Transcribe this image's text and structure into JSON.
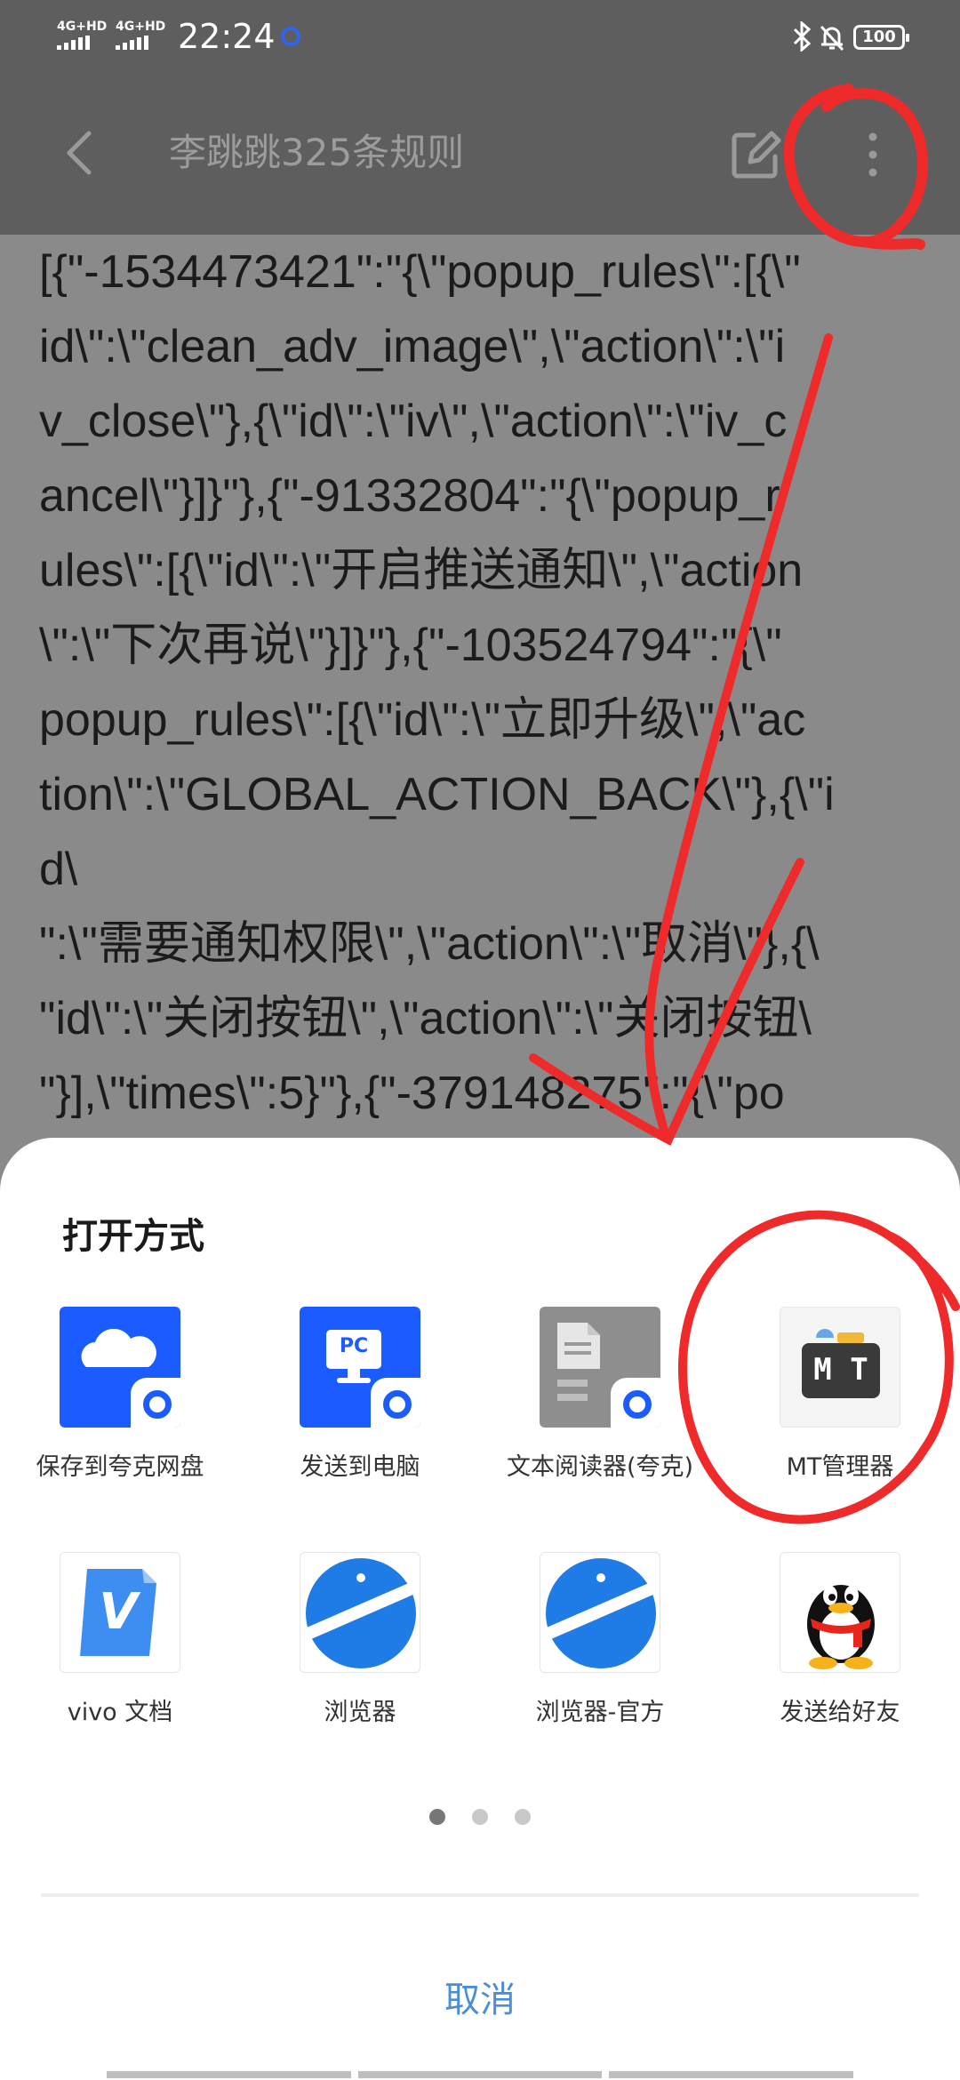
{
  "status_bar": {
    "network_1": "4G+HD",
    "network_2": "4G+HD",
    "time": "22:24",
    "battery": "100"
  },
  "header": {
    "title": "李跳跳325条规则"
  },
  "document": {
    "lines": [
      "[{\"-1534473421\":\"{\\\"popup_rules\\\":[{\\\"",
      "id\\\":\\\"clean_adv_image\\\",\\\"action\\\":\\\"i",
      "v_close\\\"},{\\\"id\\\":\\\"iv\\\",\\\"action\\\":\\\"iv_c",
      "ancel\\\"}]}\"},{\"-91332804\":\"{\\\"popup_r",
      "ules\\\":[{\\\"id\\\":\\\"开启推送通知\\\",\\\"action",
      "\\\":\\\"下次再说\\\"}]}\"},{\"-103524794\":\"{\\\"",
      "popup_rules\\\":[{\\\"id\\\":\\\"立即升级\\\",\\\"ac",
      "tion\\\":\\\"GLOBAL_ACTION_BACK\\\"},{\\\"i",
      "d\\",
      "\":\\\"需要通知权限\\\",\\\"action\\\":\\\"取消\\\"},{\\",
      "\"id\\\":\\\"关闭按钮\\\",\\\"action\\\":\\\"关闭按钮\\",
      "\"}],\\\"times\\\":5}\"},{\"-379148275\":\"{\\\"po"
    ]
  },
  "sheet": {
    "title": "打开方式",
    "apps": [
      {
        "label": "保存到夸克网盘",
        "icon": "cloud-drive-icon"
      },
      {
        "label": "发送到电脑",
        "icon": "pc-send-icon"
      },
      {
        "label": "文本阅读器(夸克)",
        "icon": "text-reader-icon"
      },
      {
        "label": "MT管理器",
        "icon": "mt-manager-icon",
        "glyph": "M T"
      },
      {
        "label": "vivo 文档",
        "icon": "vivo-docs-icon",
        "glyph": "V"
      },
      {
        "label": "浏览器",
        "icon": "browser-icon"
      },
      {
        "label": "浏览器-官方",
        "icon": "browser-official-icon"
      },
      {
        "label": "发送给好友",
        "icon": "qq-icon"
      }
    ],
    "pc_glyph": "PC",
    "cancel_label": "取消",
    "page_count": 3,
    "active_page": 1
  },
  "colors": {
    "overlay_bg": "#8a8a8a",
    "header_bg": "#5e5e5e",
    "accent": "#4a8fd6",
    "brand_blue": "#1a5cff",
    "annotation_red": "#ef2a2a"
  }
}
